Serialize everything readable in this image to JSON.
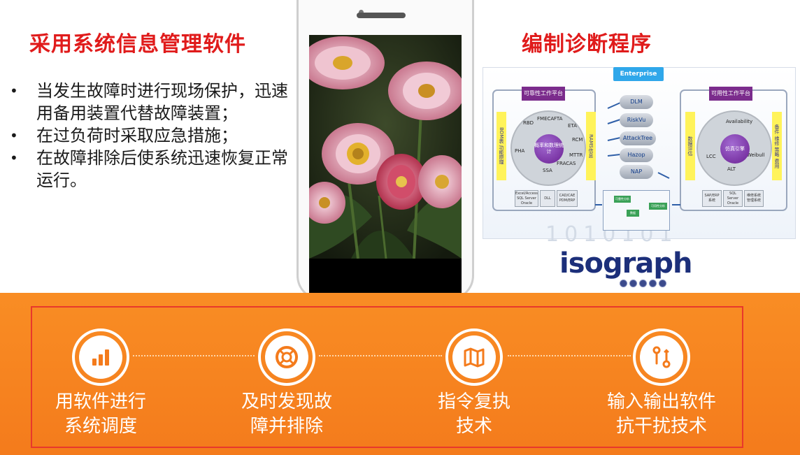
{
  "left": {
    "title": "采用系统信息管理软件",
    "bullets": [
      "当发生故障时进行现场保护，迅速用备用装置代替故障装置；",
      "在过负荷时采取应急措施；",
      "在故障排除后使系统迅速恢复正常运行。"
    ]
  },
  "right": {
    "title": "编制诊断程序",
    "diagram": {
      "header": "Enterprise",
      "left_tag": "可靠性工作平台",
      "right_tag": "可用性工作平台",
      "left_bar": "BOM表 功能原理",
      "left_bar2": "RAMS信息",
      "right_bar": "数据评估",
      "right_bar2": "备件 维修 策略 费用",
      "left_center": "概率和数理统计",
      "right_center": "仿真引擎",
      "left_segments": [
        "RBD",
        "FMECA",
        "FTA",
        "ETA",
        "RCM",
        "SSA",
        "PHA",
        "FRACAS",
        "MTTR"
      ],
      "right_segments": [
        "LCC",
        "ALT",
        "Weibull",
        "Availability"
      ],
      "tools": [
        "DLM",
        "RiskVu",
        "AttackTree",
        "Hazop",
        "NAP"
      ],
      "left_db": [
        "Excel/Access SQL Server Oracle",
        "DLL",
        "CAD/CAE PDM/ERP"
      ],
      "right_db": [
        "SAP/ERP 系统",
        "SQL Server Oracle",
        "维修系统 管理系统"
      ],
      "flow_nodes": [
        "可靠性分析",
        "数据",
        "可用性分析"
      ],
      "deco": "1010101"
    },
    "logo_text": "isograph"
  },
  "phone": {
    "screen_caption": "花朵"
  },
  "features": [
    {
      "icon": "bar-chart-icon",
      "label_line1": "用软件进行",
      "label_line2": "系统调度"
    },
    {
      "icon": "lifebuoy-icon",
      "label_line1": "及时发现故",
      "label_line2": "障并排除"
    },
    {
      "icon": "map-icon",
      "label_line1": "指令复执",
      "label_line2": "技术"
    },
    {
      "icon": "route-icon",
      "label_line1": "输入输出软件",
      "label_line2": "抗干扰技术"
    }
  ],
  "colors": {
    "title_red": "#e01b1b",
    "band_orange": "#f98d24",
    "panel_border": "#e8382c",
    "diagram_blue": "#2fa7ea",
    "diagram_purple": "#7b2c8c"
  }
}
